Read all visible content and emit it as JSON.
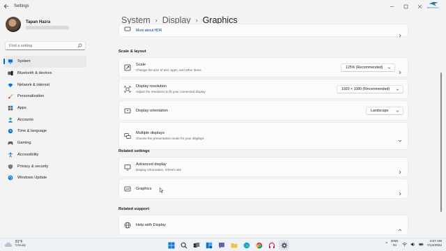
{
  "window": {
    "title": "Settings"
  },
  "logo": {
    "text": "TECHNOLOGY..."
  },
  "profile": {
    "name": "Tapan Hazra"
  },
  "search": {
    "placeholder": "Find a setting"
  },
  "sidebar": {
    "items": [
      {
        "label": "System",
        "icon": "monitor-icon",
        "active": true
      },
      {
        "label": "Bluetooth & devices",
        "icon": "bluetooth-icon"
      },
      {
        "label": "Network & internet",
        "icon": "wifi-icon"
      },
      {
        "label": "Personalization",
        "icon": "brush-icon"
      },
      {
        "label": "Apps",
        "icon": "apps-icon"
      },
      {
        "label": "Accounts",
        "icon": "person-icon"
      },
      {
        "label": "Time & language",
        "icon": "globe-clock-icon"
      },
      {
        "label": "Gaming",
        "icon": "gamepad-icon"
      },
      {
        "label": "Accessibility",
        "icon": "accessibility-icon"
      },
      {
        "label": "Privacy & security",
        "icon": "shield-icon"
      },
      {
        "label": "Windows Update",
        "icon": "update-icon"
      }
    ]
  },
  "breadcrumb": {
    "parts": [
      "System",
      "Display",
      "Graphics"
    ]
  },
  "hdr": {
    "link": "More about HDR"
  },
  "scale_layout": {
    "heading": "Scale & layout",
    "scale": {
      "title": "Scale",
      "desc": "Change the size of text, apps, and other items",
      "value": "125% (Recommended)"
    },
    "resolution": {
      "title": "Display resolution",
      "desc": "Adjust the resolution to fit your connected display",
      "value": "1920 × 1080 (Recommended)"
    },
    "orientation": {
      "title": "Display orientation",
      "value": "Landscape"
    },
    "multiple": {
      "title": "Multiple displays",
      "desc": "Choose the presentation mode for your displays"
    }
  },
  "related_settings": {
    "heading": "Related settings",
    "advanced": {
      "title": "Advanced display",
      "desc": "Display information, refresh rate"
    },
    "graphics": {
      "title": "Graphics"
    }
  },
  "related_support": {
    "heading": "Related support",
    "help": {
      "title": "Help with Display"
    }
  },
  "taskbar": {
    "weather": {
      "temp": "81°F",
      "condition": "Cloudy"
    },
    "lang": {
      "line1": "ENG",
      "line2": "IN"
    },
    "clock": {
      "time": "4:57 AM",
      "date": "7/12/2022"
    }
  },
  "colors": {
    "accent": "#0067c0",
    "background": "#f3f3f3",
    "card": "#fbfbfb"
  }
}
